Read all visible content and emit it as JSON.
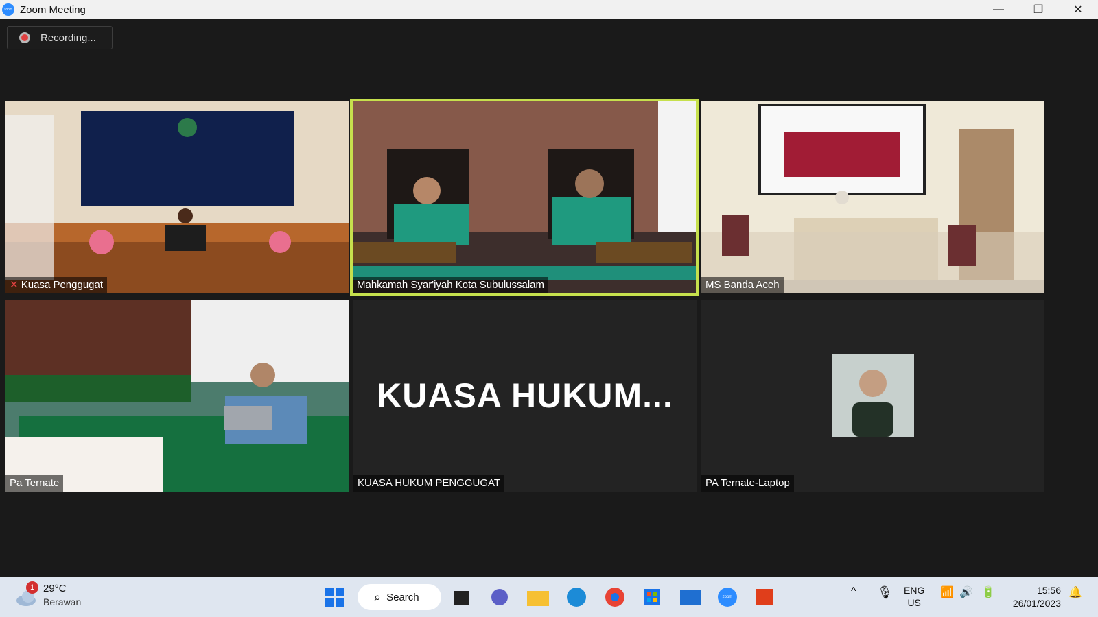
{
  "window": {
    "title": "Zoom Meeting",
    "app_logo": "zoom"
  },
  "window_controls": {
    "minimize": "—",
    "restore": "❐",
    "close": "✕"
  },
  "recording": {
    "label": "Recording..."
  },
  "tiles": [
    {
      "name": "Kuasa Penggugat",
      "muted": true
    },
    {
      "name": "Mahkamah Syar'iyah Kota Subulussalam",
      "active": true
    },
    {
      "name": "MS Banda Aceh"
    },
    {
      "name": "Pa Ternate"
    },
    {
      "name": "KUASA HUKUM PENGGUGAT",
      "display": "KUASA  HUKUM..."
    },
    {
      "name": "PA Ternate-Laptop"
    }
  ],
  "taskbar": {
    "weather": {
      "temp": "29°C",
      "condition": "Berawan",
      "badge": "1"
    },
    "search_label": "Search",
    "language": {
      "lang": "ENG",
      "region": "US"
    },
    "time": "15:56",
    "date": "26/01/2023",
    "zoom_logo": "zoom"
  },
  "colors": {
    "active_tile_border": "#c6e04d",
    "zoom_blue": "#2d8cff"
  }
}
